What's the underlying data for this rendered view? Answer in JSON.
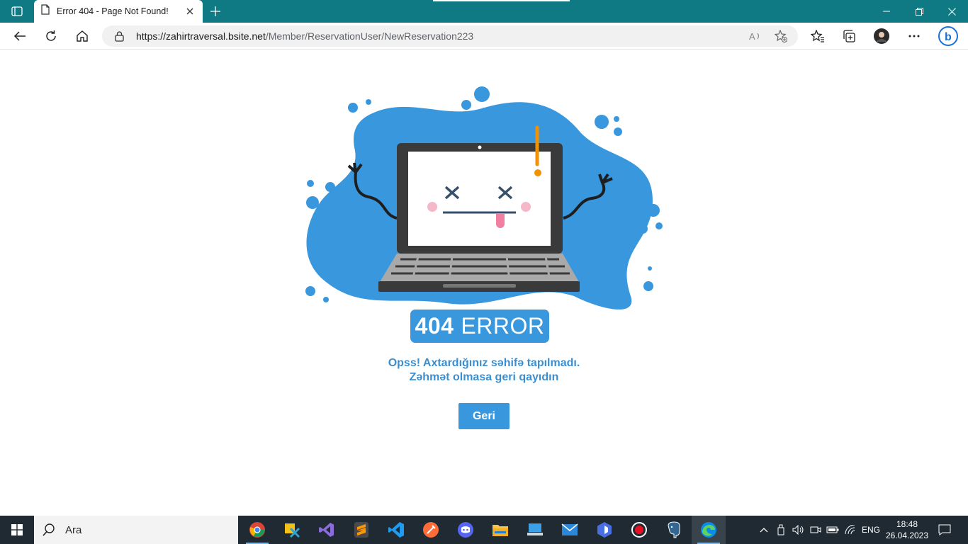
{
  "browser": {
    "tab_title": "Error 404 - Page Not Found!",
    "url_host": "https://zahirtraversal.bsite.net",
    "url_path": "/Member/ReservationUser/NewReservation223"
  },
  "page": {
    "badge_number": "404",
    "badge_word": "ERROR",
    "message_line1": "Opss! Axtardığınız səhifə tapılmadı.",
    "message_line2": "Zəhmət olmasa geri qayıdın",
    "button_label": "Geri"
  },
  "taskbar": {
    "search_placeholder": "Ara",
    "language": "ENG",
    "time": "18:48",
    "date": "26.04.2023"
  },
  "colors": {
    "browser_frame": "#0f7a84",
    "accent_blue": "#3897dd",
    "taskbar": "#1f2a33"
  }
}
